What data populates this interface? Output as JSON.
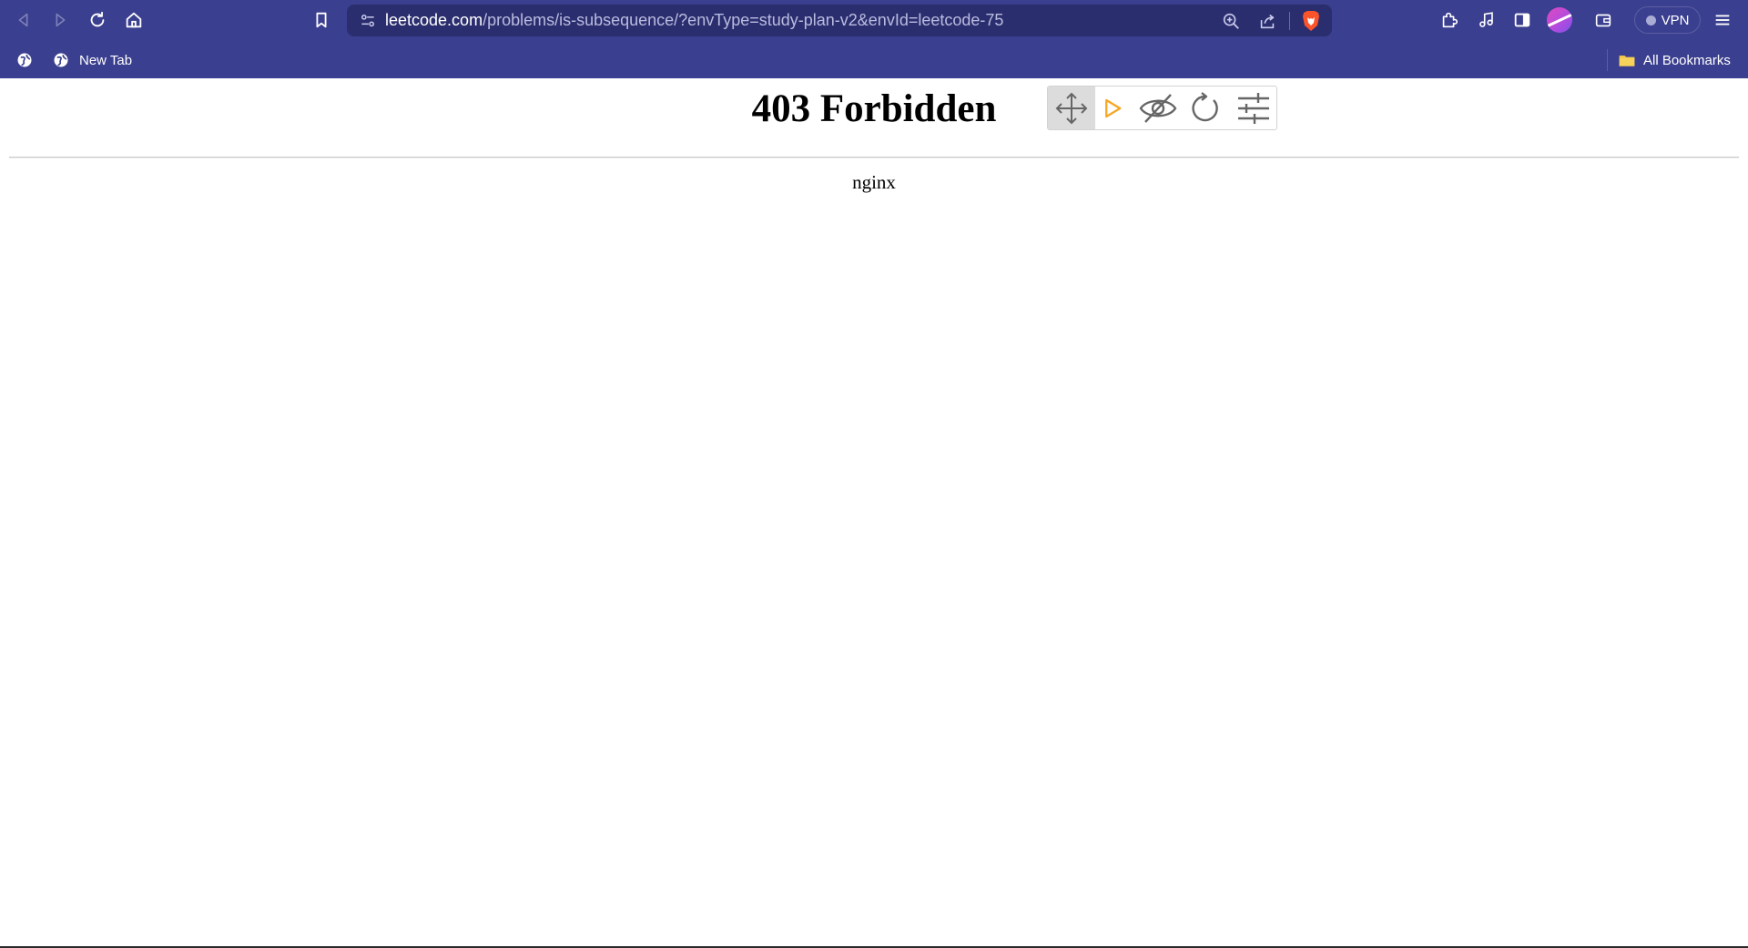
{
  "browser": {
    "url": {
      "host": "leetcode.com",
      "path": "/problems/is-subsequence/?envType=study-plan-v2&envId=leetcode-75"
    },
    "vpn_label": "VPN",
    "bookmarks": {
      "items": [
        {
          "label": "New Tab"
        }
      ],
      "all_bookmarks_label": "All Bookmarks"
    },
    "colors": {
      "chrome_bg": "#3b3f8f",
      "urlbar_bg": "#2b2e6e",
      "brave_orange": "#fb542b"
    }
  },
  "page": {
    "title": "403 Forbidden",
    "server": "nginx"
  },
  "control_bar": {
    "buttons": [
      "move-icon",
      "play-icon",
      "hide-icon",
      "reload-icon",
      "settings-icon"
    ],
    "colors": {
      "play": "#f5a623",
      "icon": "#666666",
      "active_bg": "#dcdcdc"
    }
  }
}
